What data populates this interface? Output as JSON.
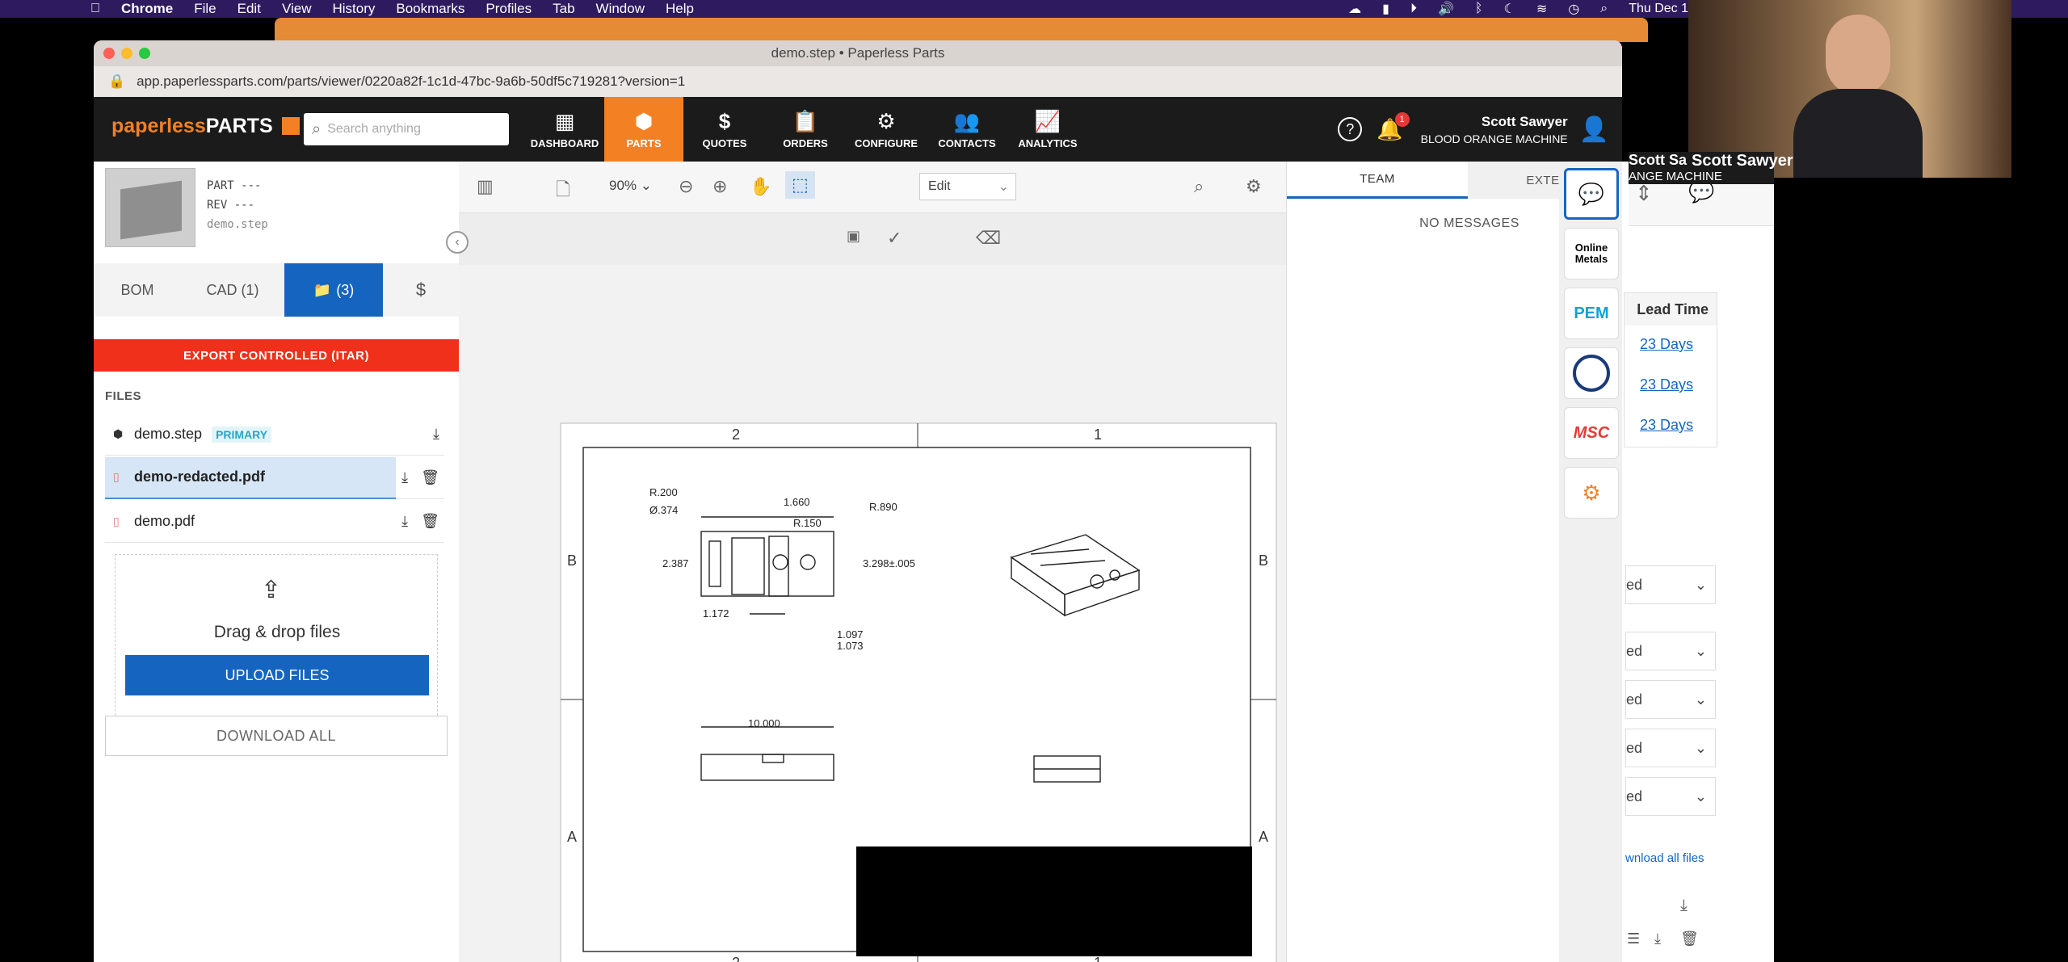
{
  "menubar": {
    "app": "Chrome",
    "items": [
      "File",
      "Edit",
      "View",
      "History",
      "Bookmarks",
      "Profiles",
      "Tab",
      "Window",
      "Help"
    ],
    "clock": "Thu Dec 1"
  },
  "browser": {
    "title": "demo.step • Paperless Parts",
    "url": "app.paperlessparts.com/parts/viewer/0220a82f-1c1d-47bc-9a6b-50df5c719281?version=1"
  },
  "header": {
    "logo_a": "paperless",
    "logo_b": "PARTS",
    "search_placeholder": "Search anything",
    "nav": [
      {
        "label": "DASHBOARD",
        "icon": "grid-icon"
      },
      {
        "label": "PARTS",
        "icon": "cube-icon"
      },
      {
        "label": "QUOTES",
        "icon": "dollar-icon"
      },
      {
        "label": "ORDERS",
        "icon": "clipboard-icon"
      },
      {
        "label": "CONFIGURE",
        "icon": "gears-icon"
      },
      {
        "label": "CONTACTS",
        "icon": "people-icon"
      },
      {
        "label": "ANALYTICS",
        "icon": "chart-icon"
      }
    ],
    "notification_count": "1",
    "user_name": "Scott Sawyer",
    "company": "BLOOD ORANGE MACHINE"
  },
  "part": {
    "part_label": "PART ---",
    "rev_label": "REV ---",
    "filename": "demo.step"
  },
  "tabs": [
    {
      "label": "BOM"
    },
    {
      "label": "CAD (1)"
    },
    {
      "label": "(3)"
    },
    {
      "label": "$"
    }
  ],
  "itar": "EXPORT CONTROLLED (ITAR)",
  "files": {
    "heading": "FILES",
    "rows": [
      {
        "name": "demo.step",
        "badge": "PRIMARY"
      },
      {
        "name": "demo-redacted.pdf"
      },
      {
        "name": "demo.pdf"
      }
    ],
    "drop_text": "Drag & drop files",
    "upload_label": "UPLOAD FILES",
    "download_all_label": "DOWNLOAD ALL"
  },
  "viewer": {
    "zoom": "90%",
    "mode": "Edit",
    "zones_top": [
      "2",
      "1"
    ],
    "zones_side": [
      "B",
      "A"
    ],
    "dims": {
      "r200": "R.200",
      "d374": "Ø.374",
      "w1660": "1.660",
      "r150": "R.150",
      "r890": "R.890",
      "h2387": "2.387",
      "h3298": "3.298±.005",
      "w1172": "1.172",
      "d1097": "1.097",
      "d1073": "1.073",
      "w10000": "10.000"
    }
  },
  "messages": {
    "tabs": [
      "TEAM",
      "EXTERNAL"
    ],
    "empty": "NO MESSAGES"
  },
  "sidebar": [
    "chat-icon",
    "Online Metals",
    "PEM",
    "seal-logo",
    "MSC",
    "gear-cluster-icon"
  ],
  "background_app": {
    "header_fragment_name": "Scott Sa",
    "header_fragment_company": "ANGE MACHINE",
    "lead_time_header": "Lead Time",
    "lead_times": [
      "23 Days",
      "23 Days",
      "23 Days"
    ],
    "select_fragments": [
      "ed",
      "ed",
      "ed",
      "ed",
      "ed"
    ],
    "download_link": "wnload all files"
  },
  "webcam": {
    "name": "Scott Sawyer"
  }
}
